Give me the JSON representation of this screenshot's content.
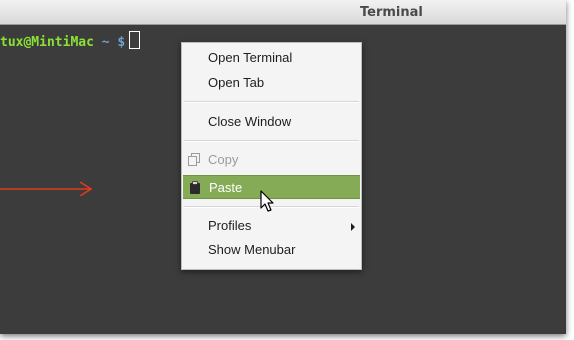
{
  "window": {
    "title": "Terminal"
  },
  "prompt": {
    "user_host": "tux@MintiMac",
    "path": "~",
    "symbol": "$"
  },
  "context_menu": {
    "items": [
      {
        "label": "Open Terminal",
        "state": "normal"
      },
      {
        "label": "Open Tab",
        "state": "normal"
      },
      {
        "label": "Close Window",
        "state": "normal"
      },
      {
        "label": "Copy",
        "state": "disabled",
        "icon": "copy-icon"
      },
      {
        "label": "Paste",
        "state": "highlighted",
        "icon": "clipboard-icon"
      },
      {
        "label": "Profiles",
        "state": "normal",
        "submenu": true
      },
      {
        "label": "Show Menubar",
        "state": "normal"
      }
    ]
  },
  "colors": {
    "terminal_bg": "#3c3c3c",
    "prompt_user": "#8ae234",
    "prompt_path": "#729fcf",
    "menu_highlight": "#86ab57",
    "annotation_arrow": "#e03a1a"
  },
  "annotation": {
    "icon": "arrow-right-icon"
  }
}
